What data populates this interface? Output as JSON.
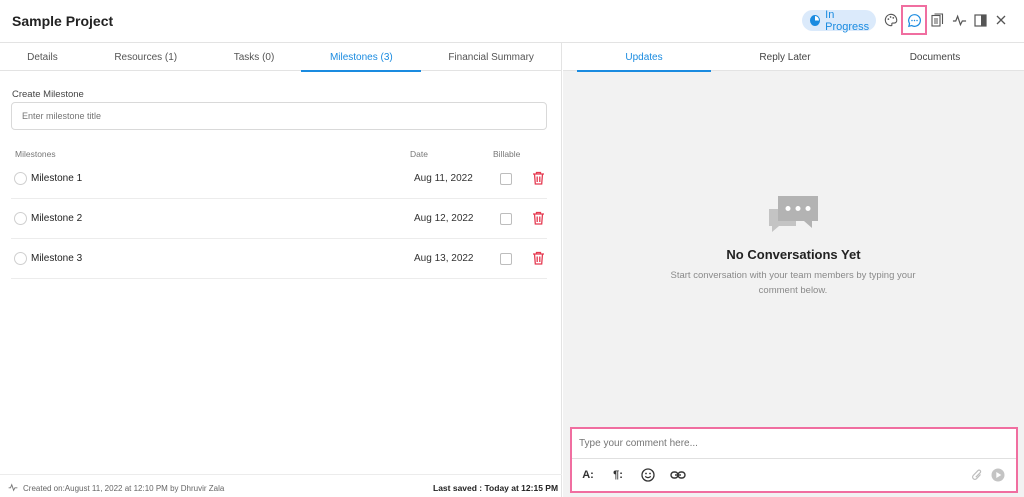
{
  "header": {
    "title": "Sample Project",
    "status": "In Progress"
  },
  "left_tabs": [
    "Details",
    "Resources (1)",
    "Tasks (0)",
    "Milestones (3)",
    "Financial Summary"
  ],
  "create": {
    "label": "Create Milestone",
    "placeholder": "Enter milestone title"
  },
  "columns": {
    "name": "Milestones",
    "date": "Date",
    "billable": "Billable"
  },
  "milestones": [
    {
      "name": "Milestone 1",
      "date": "Aug 11, 2022"
    },
    {
      "name": "Milestone 2",
      "date": "Aug 12, 2022"
    },
    {
      "name": "Milestone 3",
      "date": "Aug 13, 2022"
    }
  ],
  "footer": {
    "created": "Created on:August 11, 2022 at 12:10 PM by Dhruvir Zala",
    "saved": "Last saved : Today at 12:15 PM"
  },
  "right_tabs": [
    "Updates",
    "Reply Later",
    "Documents"
  ],
  "empty": {
    "title": "No Conversations Yet",
    "subtitle": "Start conversation with your team members by typing your comment below."
  },
  "composer": {
    "placeholder": "Type your comment here...",
    "tools": [
      "A:",
      "¶:"
    ]
  },
  "colors": {
    "accent": "#1a8be0",
    "highlight": "#f06ea0",
    "delete": "#e53950"
  },
  "icons": [
    "palette-icon",
    "chat-icon",
    "document-icon",
    "activity-icon",
    "panel-icon",
    "close-icon",
    "trash-icon",
    "emoji-icon",
    "link-icon",
    "attach-icon",
    "send-icon"
  ]
}
